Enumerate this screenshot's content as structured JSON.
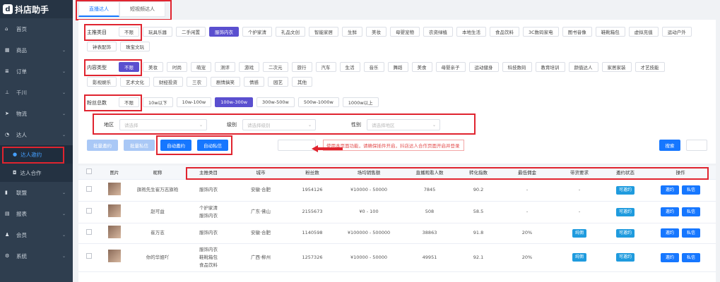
{
  "app": {
    "logo_glyph": "d",
    "title": "抖店助手"
  },
  "sidebar": {
    "items": [
      {
        "icon": "home-icon",
        "glyph": "⌂",
        "label": "首页",
        "has_chevron": false
      },
      {
        "icon": "shop-icon",
        "glyph": "▦",
        "label": "商品",
        "has_chevron": true
      },
      {
        "icon": "order-icon",
        "glyph": "≣",
        "label": "订单",
        "has_chevron": true
      },
      {
        "icon": "qianchuan-icon",
        "glyph": "⊥",
        "label": "千川",
        "has_chevron": true
      },
      {
        "icon": "logistics-icon",
        "glyph": "➤",
        "label": "物流",
        "has_chevron": true
      },
      {
        "icon": "talent-icon",
        "glyph": "◔",
        "label": "达人",
        "has_chevron": true
      }
    ],
    "sub_items": [
      {
        "icon": "chat-icon",
        "glyph": "●",
        "label": "达人邀约",
        "active": true
      },
      {
        "icon": "cooperation-icon",
        "glyph": "◘",
        "label": "达人合作",
        "active": false
      }
    ],
    "items2": [
      {
        "icon": "alliance-icon",
        "glyph": "▮",
        "label": "联盟"
      },
      {
        "icon": "report-icon",
        "glyph": "▤",
        "label": "报表"
      },
      {
        "icon": "member-icon",
        "glyph": "♟",
        "label": "会员"
      },
      {
        "icon": "settings-icon",
        "glyph": "⚙",
        "label": "系统"
      }
    ]
  },
  "tabs": [
    "直播达人",
    "短视频达人"
  ],
  "filters": {
    "category": {
      "label": "主推类目",
      "options": [
        "不限",
        "玩具乐器",
        "二手闲置",
        "服饰内衣",
        "个护家清",
        "礼品文创",
        "智能家居",
        "生鲜",
        "美妆",
        "母婴宠物",
        "农资绿植",
        "本地生活",
        "食品饮料",
        "3C数码家电",
        "图书音像",
        "鞋靴箱包",
        "虚拟充值",
        "运动户外",
        "钟表配饰",
        "珠宝文玩"
      ],
      "selected": "服饰内衣"
    },
    "content": {
      "label": "内容类型",
      "options": [
        "不限",
        "美妆",
        "时尚",
        "萌宠",
        "测评",
        "游戏",
        "二次元",
        "旅行",
        "汽车",
        "生活",
        "音乐",
        "舞蹈",
        "美食",
        "母婴亲子",
        "运动健身",
        "科技数码",
        "教育培训",
        "颜值达人",
        "家居家装",
        "才艺技能",
        "影视娱乐",
        "艺术文化",
        "财经投资",
        "三农",
        "剧情搞笑",
        "情感",
        "园艺",
        "其他"
      ],
      "selected": "不限"
    },
    "fans": {
      "label": "粉丝总数",
      "options": [
        "不限",
        "10w以下",
        "10w-100w",
        "100w-300w",
        "300w-500w",
        "500w-1000w",
        "1000w以上"
      ],
      "selected": "100w-300w"
    },
    "region": {
      "label": "地区",
      "placeholder": "请选择"
    },
    "level": {
      "label": "级别",
      "placeholder": "请选择级别"
    },
    "gender": {
      "label": "性别",
      "placeholder": "请选择地区"
    }
  },
  "actions": {
    "batch_invite": "批量邀约",
    "batch_message": "批量私信",
    "auto_invite": "自动邀约",
    "auto_message": "自动私信",
    "hint": "使用本页面功能，请确保插件开启，抖店达人合作页面开启并登录",
    "search": "搜索"
  },
  "table": {
    "columns": [
      "",
      "图片",
      "昵称",
      "主推类目",
      "城市",
      "粉丝数",
      "场均销售额",
      "直播观看人数",
      "转化指数",
      "最低佣金",
      "带货要求",
      "邀约状态",
      "操作"
    ],
    "rows": [
      {
        "name": "旗袍先生崔万志旗袍",
        "category": [
          "服饰内衣"
        ],
        "city": "安徽·合肥",
        "fans": "1954126",
        "sales": "¥10000 - 50000",
        "viewers": "7845",
        "index": "90.2",
        "commission": "-",
        "requirement": "-",
        "status": "可邀约"
      },
      {
        "name": "赵可益",
        "category": [
          "个护家清",
          "服饰内衣"
        ],
        "city": "广东·佛山",
        "fans": "2155673",
        "sales": "¥0 - 100",
        "viewers": "508",
        "index": "58.5",
        "commission": "-",
        "requirement": "-",
        "status": "可邀约"
      },
      {
        "name": "崔万志",
        "category": [
          "服饰内衣"
        ],
        "city": "安徽·合肥",
        "fans": "1140598",
        "sales": "¥100000 - 500000",
        "viewers": "38863",
        "index": "91.8",
        "commission": "20%",
        "requirement": "纯佣",
        "status": "可邀约"
      },
      {
        "name": "你的华姐吖",
        "category": [
          "服饰内衣",
          "鞋靴箱包",
          "食品饮料"
        ],
        "city": "广西·柳州",
        "fans": "1257326",
        "sales": "¥10000 - 50000",
        "viewers": "49951",
        "index": "92.1",
        "commission": "20%",
        "requirement": "纯佣",
        "status": "可邀约"
      }
    ],
    "op_invite": "邀约",
    "op_message": "私信"
  }
}
